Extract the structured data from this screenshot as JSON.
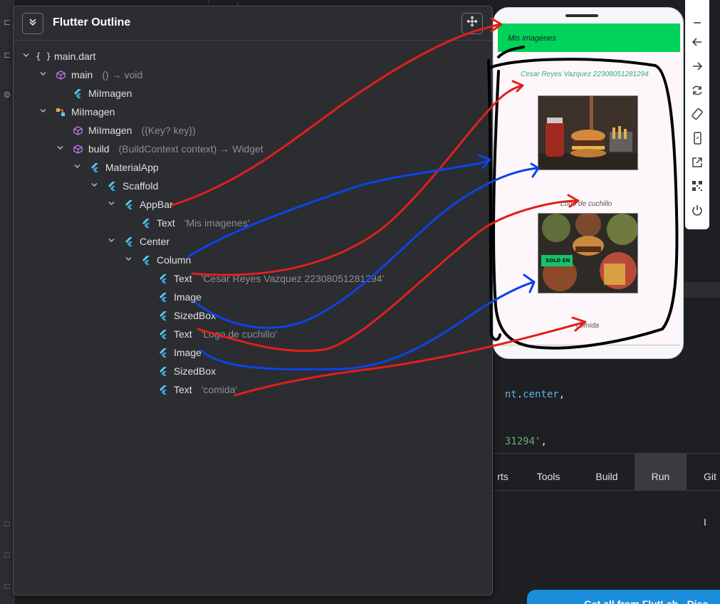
{
  "outline": {
    "title": "Flutter Outline",
    "collapse_icon": "double-chevron-down-icon",
    "move_icon": "move-arrows-icon",
    "tree": [
      {
        "name": "main.dart",
        "detail": "",
        "icon": "braces",
        "depth": 0,
        "expanded": true
      },
      {
        "name": "main",
        "detail": "() → void",
        "icon": "cube",
        "depth": 1,
        "expanded": true
      },
      {
        "name": "MiImagen",
        "detail": "",
        "icon": "flutter",
        "depth": 2,
        "expanded": null
      },
      {
        "name": "MiImagen",
        "detail": "",
        "icon": "class",
        "depth": 1,
        "expanded": true
      },
      {
        "name": "MiImagen",
        "detail": "({Key? key})",
        "icon": "cube",
        "depth": 2,
        "expanded": null
      },
      {
        "name": "build",
        "detail": "(BuildContext context) → Widget",
        "icon": "cube",
        "depth": 2,
        "expanded": true
      },
      {
        "name": "MaterialApp",
        "detail": "",
        "icon": "flutter",
        "depth": 3,
        "expanded": true
      },
      {
        "name": "Scaffold",
        "detail": "",
        "icon": "flutter",
        "depth": 4,
        "expanded": true
      },
      {
        "name": "AppBar",
        "detail": "",
        "icon": "flutter",
        "depth": 5,
        "expanded": true
      },
      {
        "name": "Text",
        "detail": "'Mis imagenes'",
        "icon": "flutter",
        "depth": 6,
        "expanded": null
      },
      {
        "name": "Center",
        "detail": "",
        "icon": "flutter",
        "depth": 5,
        "expanded": true
      },
      {
        "name": "Column",
        "detail": "",
        "icon": "flutter",
        "depth": 6,
        "expanded": true
      },
      {
        "name": "Text",
        "detail": "'Cesar Reyes Vazquez 22308051281294'",
        "icon": "flutter",
        "depth": 7,
        "expanded": null
      },
      {
        "name": "Image",
        "detail": "",
        "icon": "flutter",
        "depth": 7,
        "expanded": null
      },
      {
        "name": "SizedBox",
        "detail": "",
        "icon": "flutter",
        "depth": 7,
        "expanded": null
      },
      {
        "name": "Text",
        "detail": "'Logo de cuchillo'",
        "icon": "flutter",
        "depth": 7,
        "expanded": null
      },
      {
        "name": "Image",
        "detail": "",
        "icon": "flutter",
        "depth": 7,
        "expanded": null
      },
      {
        "name": "SizedBox",
        "detail": "",
        "icon": "flutter",
        "depth": 7,
        "expanded": null
      },
      {
        "name": "Text",
        "detail": "'comida'",
        "icon": "flutter",
        "depth": 7,
        "expanded": null
      }
    ]
  },
  "emulator": {
    "appbar_title": "Mis imagenes",
    "appbar_color": "#00d35a",
    "texts": {
      "author": "Cesar Reyes Vazquez 22308051281294",
      "logo_caption": "Logo de cuchillo",
      "food_caption": "comida",
      "badge": "SOLO EN"
    },
    "toolbar_icons": [
      "minimize-icon",
      "back-arrow-icon",
      "forward-arrow-icon",
      "rotate-icon",
      "rotate-device-icon",
      "phone-icon",
      "open-external-icon",
      "qr-code-icon",
      "power-icon"
    ]
  },
  "editor": {
    "line1_a": "nt",
    "line1_b": ".center",
    "line1_c": ",",
    "line2_a": "31294'",
    "line2_b": ","
  },
  "bottom_tabs": [
    "rts",
    "Tools",
    "Build",
    "Run",
    "Git I"
  ],
  "bottom_tabs_active": "Run",
  "promo_text": "Get all from FlutLab - Disc",
  "annotation_colors": {
    "red": "#e0201b",
    "blue": "#0c43e8",
    "black": "#000000"
  }
}
